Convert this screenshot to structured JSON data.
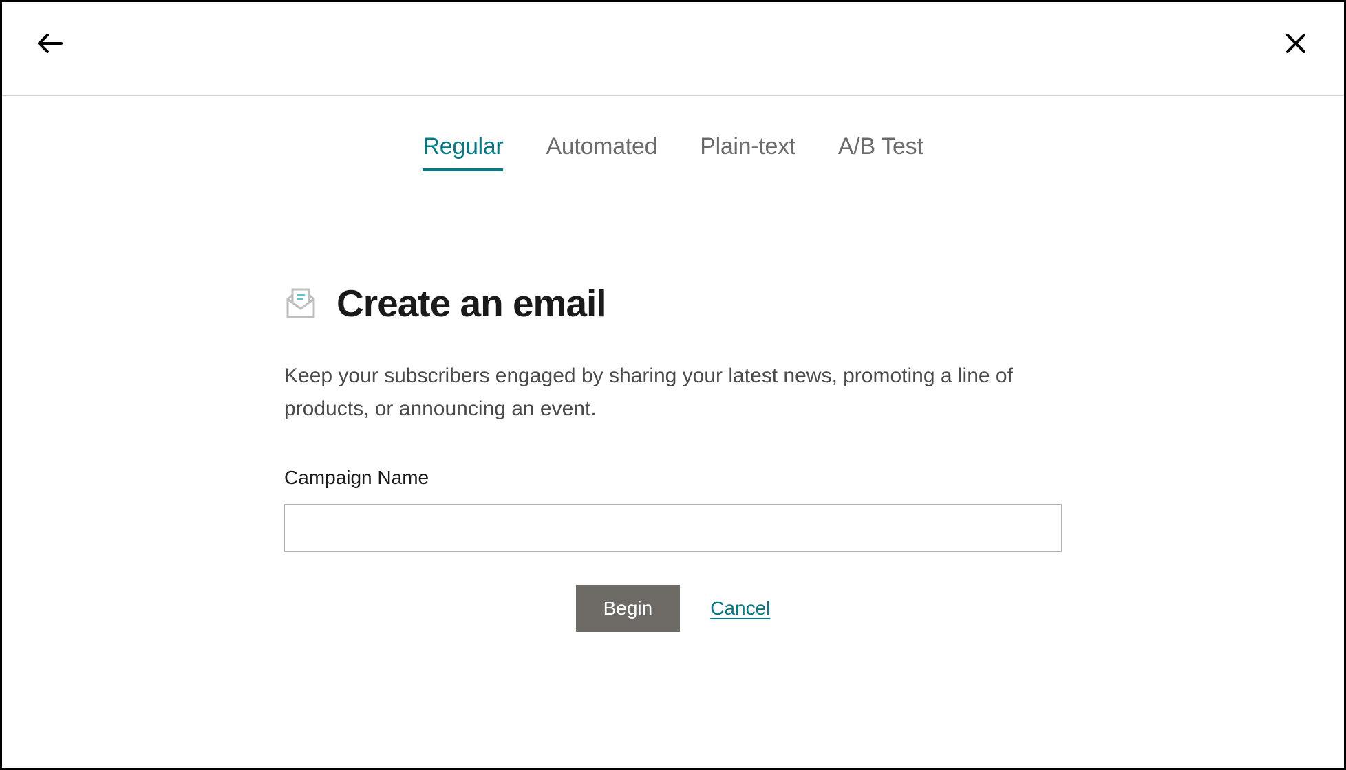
{
  "header": {
    "back_icon": "back",
    "close_icon": "close"
  },
  "tabs": [
    {
      "label": "Regular",
      "active": true
    },
    {
      "label": "Automated",
      "active": false
    },
    {
      "label": "Plain-text",
      "active": false
    },
    {
      "label": "A/B Test",
      "active": false
    }
  ],
  "main": {
    "title": "Create an email",
    "description": "Keep your subscribers engaged by sharing your latest news, promoting a line of products, or announcing an event.",
    "campaign_name_label": "Campaign Name",
    "campaign_name_value": "",
    "begin_label": "Begin",
    "cancel_label": "Cancel"
  },
  "colors": {
    "accent": "#007c89",
    "text_primary": "#1a1a1a",
    "text_secondary": "#6b6b6b",
    "button_bg": "#6e6a66"
  }
}
